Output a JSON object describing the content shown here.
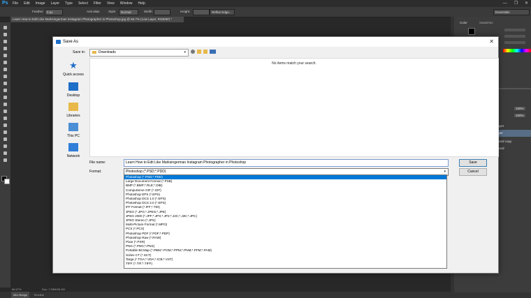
{
  "app": {
    "logo": "Ps",
    "menus": [
      "File",
      "Edit",
      "Image",
      "Layer",
      "Type",
      "Select",
      "Filter",
      "View",
      "Window",
      "Help"
    ],
    "window_controls": [
      "—",
      "❐",
      "✕"
    ]
  },
  "options_bar": {
    "feather_label": "Feather:",
    "feather_value": "0 px",
    "antialias_label": "Anti-alias",
    "style_label": "Style:",
    "style_value": "Normal",
    "width_label": "Width:",
    "height_label": "Height:",
    "refine_label": "Refine Edge...",
    "workspace": "Essentials"
  },
  "document_tab": "Learn How to Edit Like Marksingerman Instagram Photographer in Photoshop.jpg @ 66.7% (Low Layer, RGB/8#) *",
  "status": {
    "zoom": "66.67%",
    "doc": "Doc: 7.03M/26.1M"
  },
  "bottom_tabs": [
    "Mini Bridge",
    "Timeline"
  ],
  "right_panel": {
    "tabs": [
      "Color",
      "Swatches"
    ],
    "layer_labels": [
      "Opacity:",
      "Fill:",
      "Layer",
      "layer",
      "round copy",
      "round"
    ],
    "opacity": "100%",
    "fill": "100%"
  },
  "dialog": {
    "title": "Save As",
    "save_in_label": "Save in:",
    "save_in_value": "Downloads",
    "places": [
      {
        "label": "Quick access",
        "icon": "star-icon"
      },
      {
        "label": "Desktop",
        "icon": "desktop-icon"
      },
      {
        "label": "Libraries",
        "icon": "libraries-icon"
      },
      {
        "label": "This PC",
        "icon": "computer-icon"
      },
      {
        "label": "Network",
        "icon": "network-icon"
      }
    ],
    "empty_message": "No items match your search.",
    "file_name_label": "File name:",
    "file_name_value": "Learn How to Edit Like Marksingerman Instagram Photographer in Photoshop",
    "format_label": "Format:",
    "format_value": "Photoshop (*.PSD;*.PDD)",
    "save_button": "Save",
    "cancel_button": "Cancel",
    "format_options": [
      "Photoshop (*.PSD;*.PDD)",
      "Large Document Format (*.PSB)",
      "BMP (*.BMP;*.RLE;*.DIB)",
      "CompuServe GIF (*.GIF)",
      "Photoshop EPS (*.EPS)",
      "Photoshop DCS 1.0 (*.EPS)",
      "Photoshop DCS 2.0 (*.EPS)",
      "IFF Format (*.IFF;*.TDI)",
      "JPEG (*.JPG;*.JPEG;*.JPE)",
      "JPEG 2000 (*.JPF;*.JPX;*.JP2;*.J2C;*.J2K;*.JPC)",
      "JPEG Stereo (*.JPS)",
      "Multi-Picture Format (*.MPO)",
      "PCX (*.PCX)",
      "Photoshop PDF (*.PDF;*.PDP)",
      "Photoshop Raw (*.RAW)",
      "Pixar (*.PXR)",
      "PNG (*.PNG;*.PNS)",
      "Portable Bit Map (*.PBM;*.PGM;*.PPM;*.PNM;*.PFM;*.PAM)",
      "Scitex CT (*.SCT)",
      "Targa (*.TGA;*.VDA;*.ICB;*.VST)",
      "TIFF (*.TIF;*.TIFF)"
    ],
    "selected_option_index": 0
  },
  "colors": {
    "accent": "#0078d7",
    "ps_blue": "#31a8ff",
    "dark_bg": "#282828"
  }
}
